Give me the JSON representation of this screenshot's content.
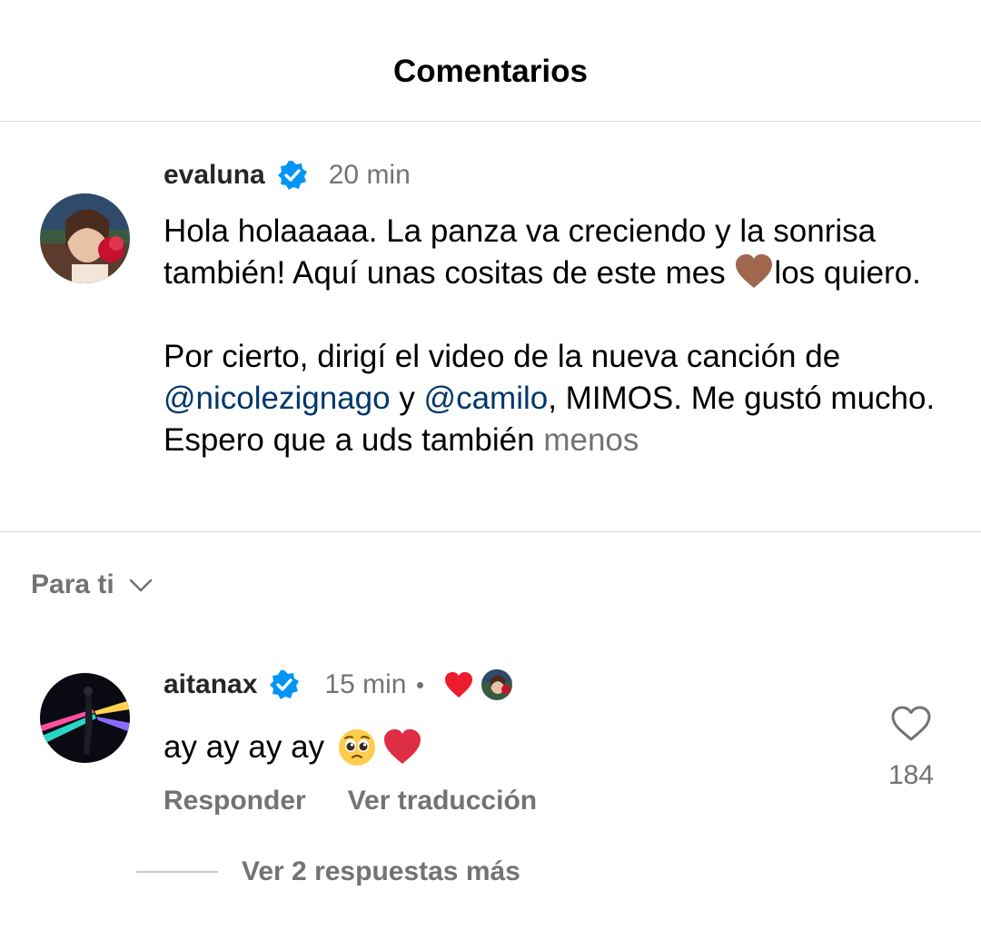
{
  "header": {
    "title": "Comentarios"
  },
  "caption": {
    "username": "evaluna",
    "verified": true,
    "time": "20 min",
    "line1": "Hola holaaaaa. La panza va creciendo y la sonrisa también! Aquí unas cositas de este mes ",
    "line1_emoji": "brown-heart-emoji",
    "line1_end": "los quiero.",
    "p2_a": "Por cierto, dirigí el video de la nueva canción de ",
    "mention1": "@nicolezignago",
    "p2_b": " y ",
    "mention2": "@camilo",
    "p2_c": ", MIMOS. Me gustó mucho. Espero que a uds también ",
    "less_label": "menos"
  },
  "sort": {
    "label": "Para ti",
    "icon": "chevron-down-icon"
  },
  "comment": {
    "username": "aitanax",
    "verified": true,
    "time": "15 min",
    "liked_by_author_icon": "red-heart-icon",
    "text": "ay ay ay ay",
    "emojis": [
      "pleading-face-emoji",
      "red-heart-emoji"
    ],
    "reply_label": "Responder",
    "translate_label": "Ver traducción",
    "like_count": "184",
    "view_replies_label": "Ver 2 respuestas más"
  },
  "colors": {
    "verified_blue": "#0095f6",
    "mention": "#00376b",
    "secondary_text": "#737373",
    "heart_red": "#ed1b2e",
    "divider": "#dbdbdb"
  }
}
